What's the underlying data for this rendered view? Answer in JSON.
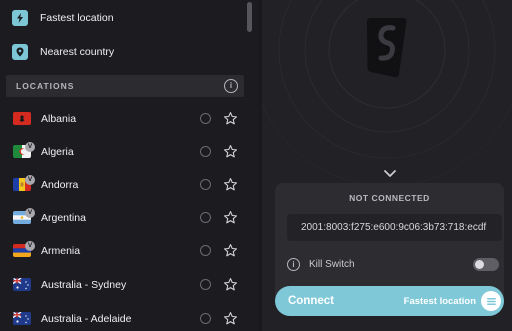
{
  "quick_connect": [
    {
      "label": "Fastest location",
      "icon": "lightning-icon"
    },
    {
      "label": "Nearest country",
      "icon": "location-pin-icon"
    }
  ],
  "locations_header": {
    "title": "LOCATIONS",
    "info": "i"
  },
  "locations": [
    {
      "name": "Albania",
      "flag": "albania",
      "virtual": false
    },
    {
      "name": "Algeria",
      "flag": "algeria",
      "virtual": true
    },
    {
      "name": "Andorra",
      "flag": "andorra",
      "virtual": true
    },
    {
      "name": "Argentina",
      "flag": "argentina",
      "virtual": true
    },
    {
      "name": "Armenia",
      "flag": "armenia",
      "virtual": true
    },
    {
      "name": "Australia - Sydney",
      "flag": "australia",
      "virtual": false
    },
    {
      "name": "Australia - Adelaide",
      "flag": "australia",
      "virtual": false
    }
  ],
  "virtual_badge": "V",
  "status": {
    "text": "NOT CONNECTED",
    "ip": "2001:8003:f275:e600:9c06:3b73:718:ecdf",
    "kill_switch_label": "Kill Switch",
    "kill_switch_on": false,
    "info": "i"
  },
  "connect": {
    "label": "Connect",
    "target": "Fastest location"
  },
  "colors": {
    "accent": "#7ec8d8",
    "background": "#1d1d21",
    "card": "#2c2c31"
  }
}
